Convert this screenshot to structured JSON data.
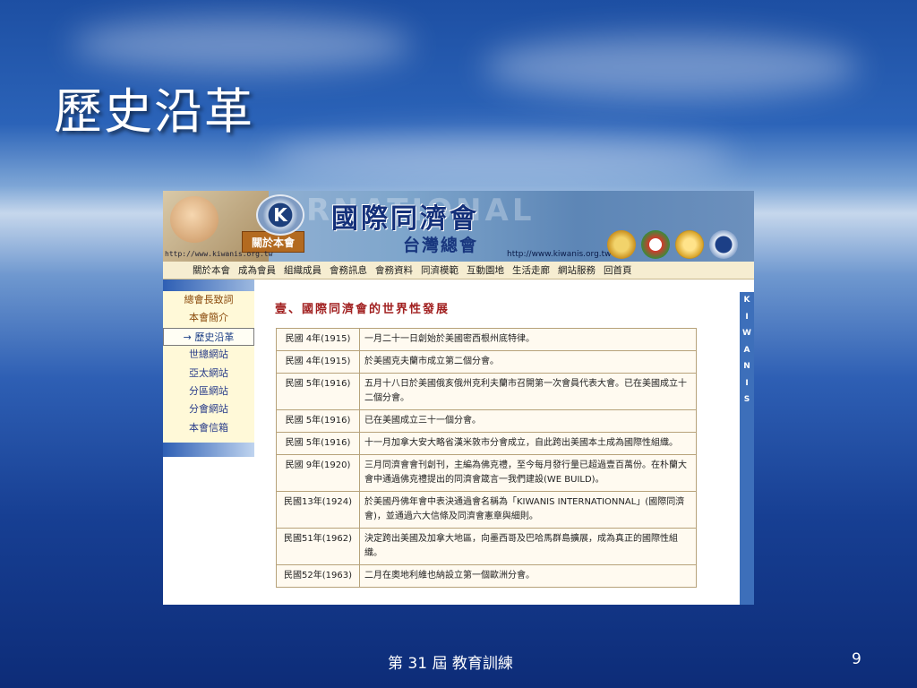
{
  "slide": {
    "title": "歷史沿革",
    "footer_text": "第 31 屆 教育訓練",
    "page_number": "9"
  },
  "site": {
    "banner": {
      "main_title": "國際同濟會",
      "sub_title": "台灣總會",
      "about_tag": "關於本會",
      "url_left": "http://www.kiwanis.org.tw",
      "url_right": "http://www.kiwanis.org.tw",
      "watermark": "RNATIONAL"
    },
    "nav": [
      "關於本會",
      "成為會員",
      "組織成員",
      "會務訊息",
      "會務資料",
      "同濟模範",
      "互動園地",
      "生活走廊",
      "網站服務",
      "回首頁"
    ],
    "sidebar": [
      {
        "label": "總會長致詞",
        "active": false
      },
      {
        "label": "本會簡介",
        "active": false
      },
      {
        "label": "→ 歷史沿革",
        "active": true
      },
      {
        "label": "世總網站",
        "active": false
      },
      {
        "label": "亞太網站",
        "active": false
      },
      {
        "label": "分區網站",
        "active": false
      },
      {
        "label": "分會網站",
        "active": false
      },
      {
        "label": "本會信箱",
        "active": false
      }
    ],
    "section_heading": "壹、國際同濟會的世界性發展",
    "history": [
      {
        "year": "民國 4年(1915)",
        "event": "一月二十一日創始於美國密西根州底特律。"
      },
      {
        "year": "民國 4年(1915)",
        "event": "於美國克夫蘭市成立第二個分會。"
      },
      {
        "year": "民國 5年(1916)",
        "event": "五月十八日於美國俄亥俄州克利夫蘭市召開第一次會員代表大會。已在美國成立十二個分會。"
      },
      {
        "year": "民國 5年(1916)",
        "event": "已在美國成立三十一個分會。"
      },
      {
        "year": "民國 5年(1916)",
        "event": "十一月加拿大安大略省漢米敦市分會成立，自此跨出美國本土成為國際性組織。"
      },
      {
        "year": "民國 9年(1920)",
        "event": "三月同濟會會刊創刊，主編為佛克禮，至今每月發行量已超過壹百萬份。在朴蘭大會中通過佛克禮提出的同濟會箴言一我們建設(WE BUILD)。"
      },
      {
        "year": "民國13年(1924)",
        "event": "於美國丹佛年會中表決通過會名稱為「KIWANIS INTERNATIONNAL」(國際同濟會)，並通過六大信條及同濟會憲章與細則。"
      },
      {
        "year": "民國51年(1962)",
        "event": "決定跨出美國及加拿大地區，向墨西哥及巴哈馬群島擴展，成為真正的國際性組織。"
      },
      {
        "year": "民國52年(1963)",
        "event": "二月在奧地利維也納設立第一個歐洲分會。"
      }
    ],
    "right_strip_letters": [
      "K",
      "I",
      "W",
      "A",
      "N",
      "I",
      "S"
    ]
  },
  "colors": {
    "accent_red": "#a12020",
    "nav_bg": "#f6edd1",
    "sidebar_bg": "#fff9d8",
    "slide_blue": "#1d4fa3"
  }
}
